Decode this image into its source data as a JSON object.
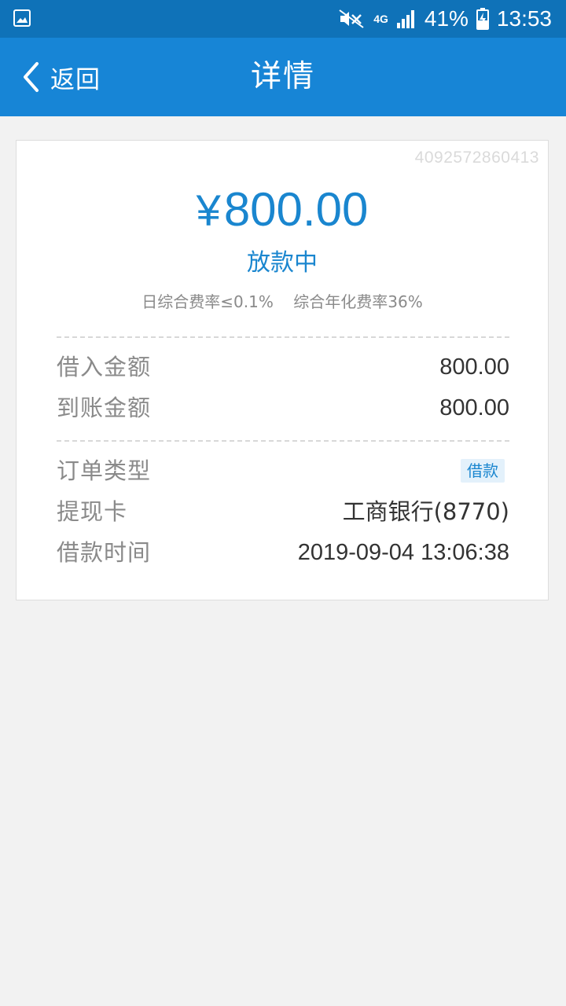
{
  "status_bar": {
    "battery": "41%",
    "network": "4G",
    "time": "13:53",
    "icons": [
      "image-icon",
      "mute-icon",
      "signal-icon",
      "battery-charging-icon"
    ]
  },
  "app_bar": {
    "back_label": "返回",
    "title": "详情",
    "color": "#1785d6"
  },
  "detail": {
    "order_id": "4092572860413",
    "currency": "¥",
    "amount": "800.00",
    "status": "放款中",
    "rates": "日综合费率≤0.1%    综合年化费率36%",
    "accent_color": "#1a86cf",
    "rows": [
      {
        "label": "借入金额",
        "value": "800.00"
      },
      {
        "label": "到账金额",
        "value": "800.00"
      },
      {
        "label": "订单类型",
        "badge": "借款"
      },
      {
        "label": "提现卡",
        "value": "工商银行(8770)"
      },
      {
        "label": "借款时间",
        "value": "2019-09-04 13:06:38"
      }
    ]
  }
}
